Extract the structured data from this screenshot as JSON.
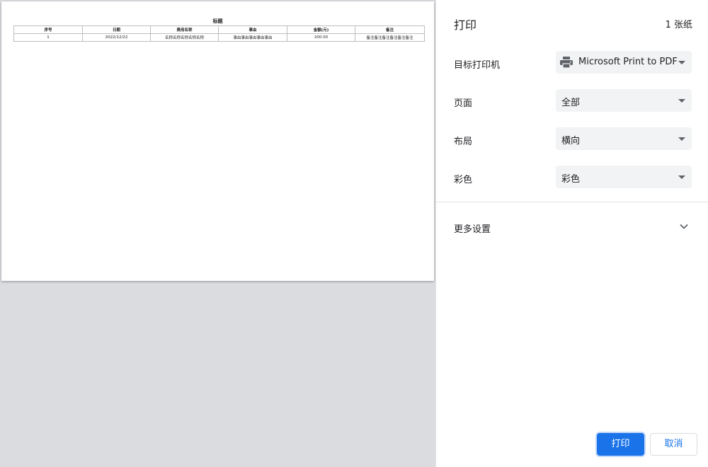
{
  "preview": {
    "doc_title": "标题",
    "table": {
      "headers": [
        "序号",
        "日期",
        "费用名称",
        "事由",
        "金额(元)",
        "备注"
      ],
      "rows": [
        [
          "1",
          "2022/12/22",
          "名称名称名称名称名称",
          "事由事由事由事由事由",
          "200.00",
          "备注备注备注备注备注备注"
        ]
      ]
    }
  },
  "panel": {
    "title": "打印",
    "sheet_count": "1 张纸",
    "destination": {
      "label": "目标打印机",
      "value": "Microsoft Print to PDF",
      "icon": "printer-icon"
    },
    "pages": {
      "label": "页面",
      "value": "全部"
    },
    "layout": {
      "label": "布局",
      "value": "横向"
    },
    "color": {
      "label": "彩色",
      "value": "彩色"
    },
    "more_settings": {
      "label": "更多设置",
      "icon": "chevron-down-icon"
    },
    "print_button": "打印",
    "cancel_button": "取消"
  },
  "colors": {
    "accent": "#1a73e8",
    "preview_bg": "#dadce0",
    "select_bg": "#f1f3f4"
  }
}
